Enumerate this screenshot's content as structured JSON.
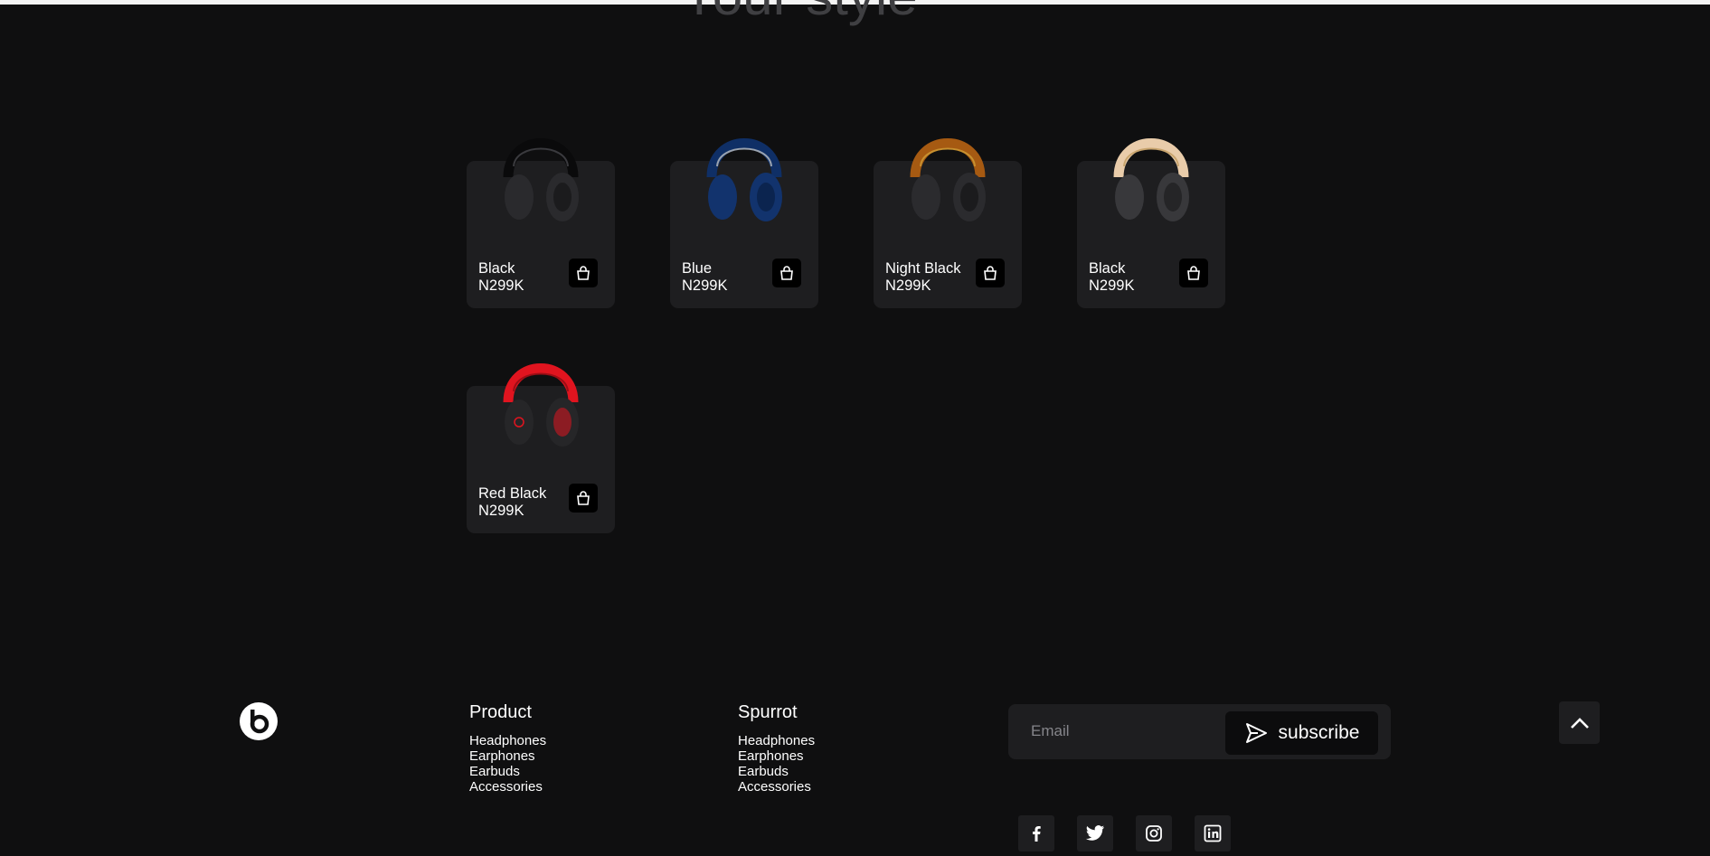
{
  "hero": {
    "heading": "Your style"
  },
  "products": [
    {
      "color_name": "Black",
      "price": "N299K",
      "band_color": "#0a0a0b",
      "cup_color": "#2a2a2d",
      "accent": "#3a3a3e"
    },
    {
      "color_name": "Blue",
      "price": "N299K",
      "band_color": "#0f2f66",
      "cup_color": "#12336d",
      "accent": "#9aa3b0"
    },
    {
      "color_name": "Night Black",
      "price": "N299K",
      "band_color": "#a65a12",
      "cup_color": "#2b2b2e",
      "accent": "#c7902f"
    },
    {
      "color_name": "Black",
      "price": "N299K",
      "band_color": "#e9ccaa",
      "cup_color": "#38383b",
      "accent": "#c9a56e"
    },
    {
      "color_name": "Red Black",
      "price": "N299K",
      "band_color": "#e0141f",
      "cup_color": "#262628",
      "accent": "#e0141f"
    }
  ],
  "footer": {
    "logo_icon": "beats-logo-icon",
    "columns": [
      {
        "title": "Product",
        "links": [
          "Headphones",
          "Earphones",
          "Earbuds",
          "Accessories"
        ]
      },
      {
        "title": "Spurrot",
        "links": [
          "Headphones",
          "Earphones",
          "Earbuds",
          "Accessories"
        ]
      }
    ],
    "subscribe": {
      "placeholder": "Email",
      "button_label": "subscribe"
    },
    "social": [
      "facebook-icon",
      "twitter-icon",
      "instagram-icon",
      "linkedin-icon"
    ]
  },
  "colors": {
    "background": "#0f0f10",
    "card": "#1e1e20",
    "button": "#000000"
  }
}
